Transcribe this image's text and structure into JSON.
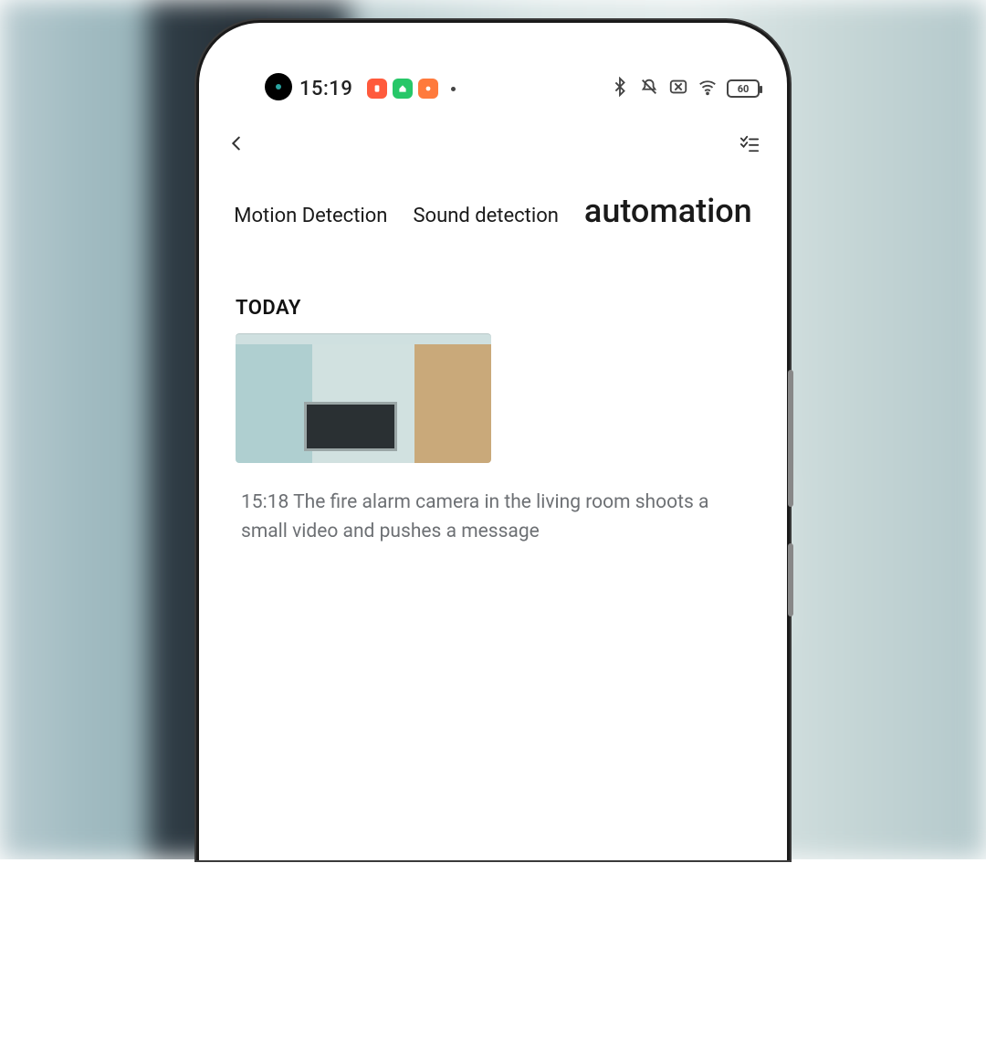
{
  "status": {
    "time": "15:19",
    "battery": "60"
  },
  "tabs": {
    "motion": "Motion Detection",
    "sound": "Sound detection",
    "automation": "automation"
  },
  "section": {
    "heading": "TODAY"
  },
  "event": {
    "time": "15:18",
    "text": "15:18 The fire alarm camera in the living room shoots a small video and pushes a message"
  }
}
